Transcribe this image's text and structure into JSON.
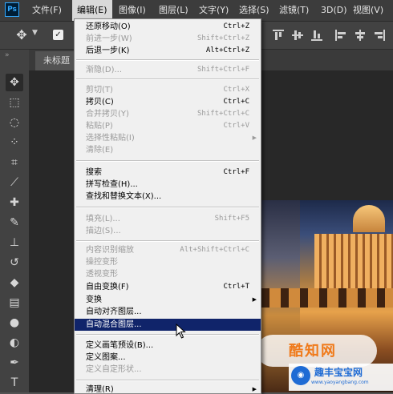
{
  "app": {
    "logo": "Ps"
  },
  "menubar": {
    "items": [
      {
        "label": "文件(F)"
      },
      {
        "label": "编辑(E)"
      },
      {
        "label": "图像(I)"
      },
      {
        "label": "图层(L)"
      },
      {
        "label": "文字(Y)"
      },
      {
        "label": "选择(S)"
      },
      {
        "label": "滤镜(T)"
      },
      {
        "label": "3D(D)"
      },
      {
        "label": "视图(V)"
      }
    ]
  },
  "document": {
    "tab_title": "未标题"
  },
  "edit_menu": {
    "items": [
      {
        "label": "还原移动(O)",
        "shortcut": "Ctrl+Z",
        "disabled": false
      },
      {
        "label": "前进一步(W)",
        "shortcut": "Shift+Ctrl+Z",
        "disabled": true
      },
      {
        "label": "后退一步(K)",
        "shortcut": "Alt+Ctrl+Z",
        "disabled": false
      },
      {
        "label": "渐隐(D)...",
        "shortcut": "Shift+Ctrl+F",
        "disabled": true
      },
      {
        "label": "剪切(T)",
        "shortcut": "Ctrl+X",
        "disabled": true
      },
      {
        "label": "拷贝(C)",
        "shortcut": "Ctrl+C",
        "disabled": false
      },
      {
        "label": "合并拷贝(Y)",
        "shortcut": "Shift+Ctrl+C",
        "disabled": true
      },
      {
        "label": "粘贴(P)",
        "shortcut": "Ctrl+V",
        "disabled": true
      },
      {
        "label": "选择性粘贴(I)",
        "shortcut": "",
        "disabled": true,
        "submenu": true
      },
      {
        "label": "清除(E)",
        "shortcut": "",
        "disabled": true
      },
      {
        "label": "搜索",
        "shortcut": "Ctrl+F",
        "disabled": false
      },
      {
        "label": "拼写检查(H)...",
        "shortcut": "",
        "disabled": false
      },
      {
        "label": "查找和替换文本(X)...",
        "shortcut": "",
        "disabled": false
      },
      {
        "label": "填充(L)...",
        "shortcut": "Shift+F5",
        "disabled": true
      },
      {
        "label": "描边(S)...",
        "shortcut": "",
        "disabled": true
      },
      {
        "label": "内容识别缩放",
        "shortcut": "Alt+Shift+Ctrl+C",
        "disabled": true
      },
      {
        "label": "操控变形",
        "shortcut": "",
        "disabled": true
      },
      {
        "label": "透视变形",
        "shortcut": "",
        "disabled": true
      },
      {
        "label": "自由变换(F)",
        "shortcut": "Ctrl+T",
        "disabled": false
      },
      {
        "label": "变换",
        "shortcut": "",
        "disabled": false,
        "submenu": true
      },
      {
        "label": "自动对齐图层...",
        "shortcut": "",
        "disabled": false
      },
      {
        "label": "自动混合图层...",
        "shortcut": "",
        "disabled": false,
        "highlighted": true
      },
      {
        "label": "定义画笔预设(B)...",
        "shortcut": "",
        "disabled": false
      },
      {
        "label": "定义图案...",
        "shortcut": "",
        "disabled": false
      },
      {
        "label": "定义自定形状...",
        "shortcut": "",
        "disabled": true
      },
      {
        "label": "清理(R)",
        "shortcut": "",
        "disabled": false,
        "submenu": true
      }
    ]
  },
  "watermark": {
    "brand": "酷知网",
    "site_title": "趣丰宝宝网",
    "site_url": "www.yaoyangbang.com"
  },
  "colors": {
    "highlight": "#10246a",
    "menubar": "#3c3c3c",
    "panel": "#424242"
  },
  "icons": [
    "move-icon",
    "marquee-icon",
    "lasso-icon",
    "quick-select-icon",
    "crop-icon",
    "eyedropper-icon",
    "healing-icon",
    "brush-icon",
    "clone-stamp-icon",
    "history-brush-icon",
    "eraser-icon",
    "gradient-icon",
    "blur-icon",
    "dodge-icon",
    "pen-icon",
    "type-icon"
  ]
}
